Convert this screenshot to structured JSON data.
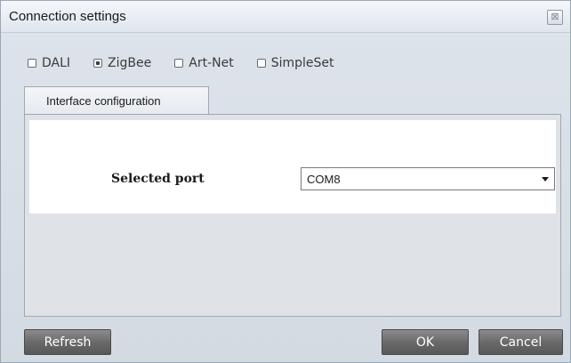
{
  "window": {
    "title": "Connection settings",
    "close_glyph": "⊠"
  },
  "protocols": [
    {
      "label": "DALI",
      "checked": false
    },
    {
      "label": "ZigBee",
      "checked": true
    },
    {
      "label": "Art-Net",
      "checked": false
    },
    {
      "label": "SimpleSet",
      "checked": false
    }
  ],
  "tabs": [
    {
      "label": "Interface configuration"
    }
  ],
  "interface": {
    "port_label": "Selected port",
    "port_value": "COM8"
  },
  "buttons": {
    "refresh": "Refresh",
    "ok": "OK",
    "cancel": "Cancel"
  }
}
